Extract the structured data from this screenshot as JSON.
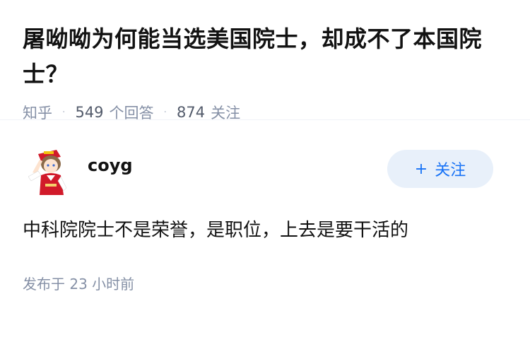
{
  "question": {
    "title": "屠呦呦为何能当选美国院士，却成不了本国院士？",
    "source": "知乎",
    "answer_count": "549",
    "answer_label": "个回答",
    "follower_count": "874",
    "follower_label": "关注",
    "separator": "·"
  },
  "answer": {
    "author_name": "coyg",
    "follow_button": {
      "icon": "plus-icon",
      "plus": "+",
      "label": "关注"
    },
    "content": "中科院院士不是荣誉，是职位，上去是要干活的",
    "publish_prefix": "发布于",
    "publish_time": "23 小时前"
  },
  "colors": {
    "accent": "#1772f6",
    "accent_bg": "#e8f0fa",
    "meta": "#8590a6",
    "text": "#121212"
  }
}
